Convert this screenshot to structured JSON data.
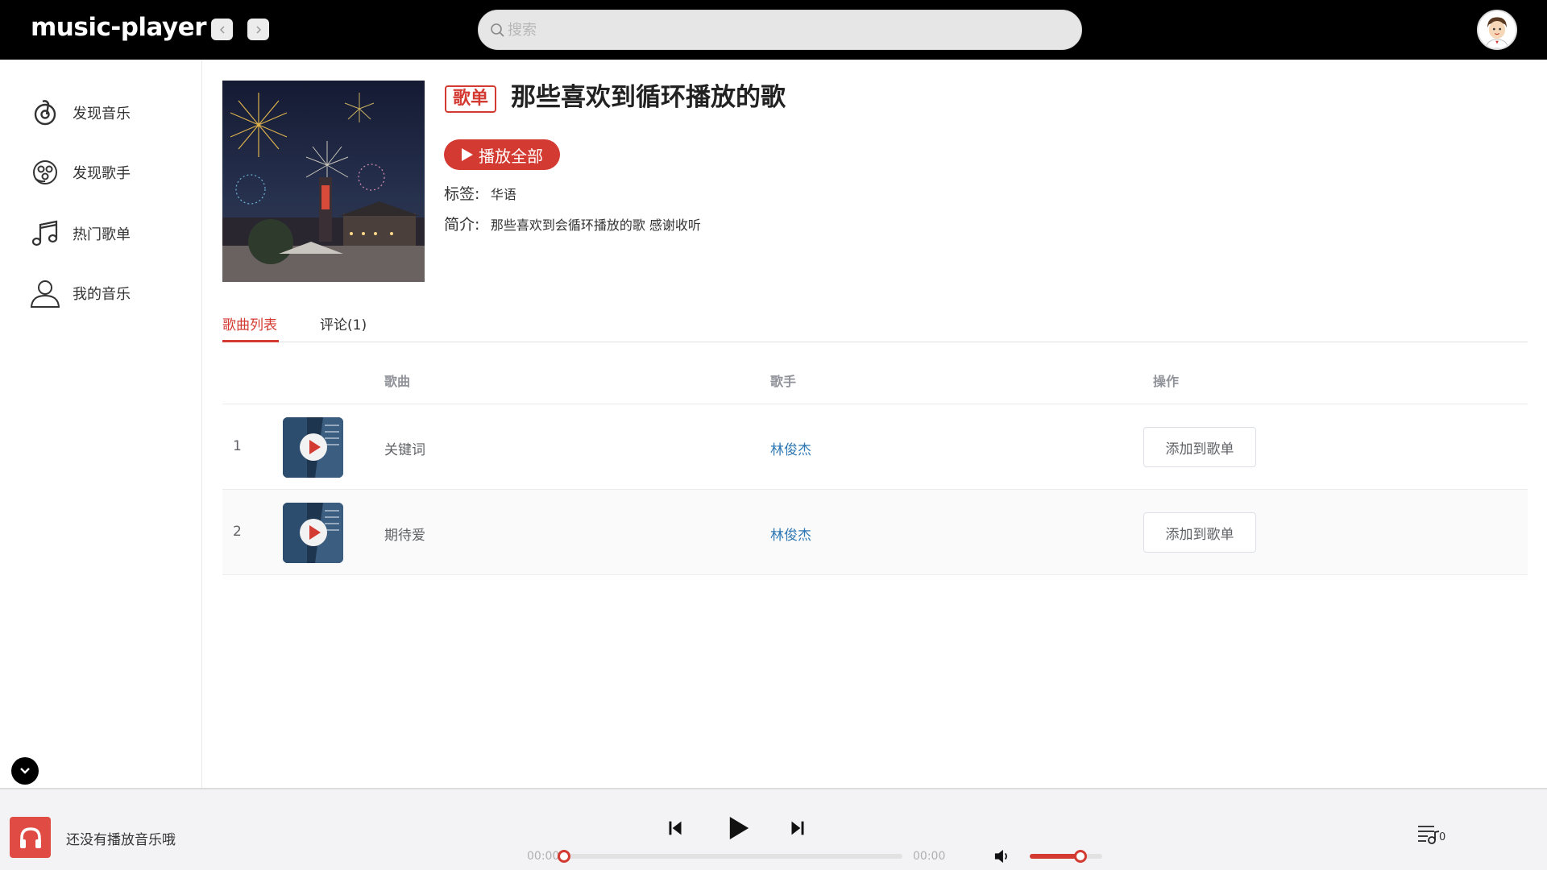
{
  "app": {
    "logo": "music-player"
  },
  "search": {
    "placeholder": "搜索",
    "value": ""
  },
  "sidebar": {
    "items": [
      {
        "label": "发现音乐",
        "icon": "netease-music-icon"
      },
      {
        "label": "发现歌手",
        "icon": "singer-disc-icon"
      },
      {
        "label": "热门歌单",
        "icon": "music-note-icon"
      },
      {
        "label": "我的音乐",
        "icon": "user-icon"
      }
    ]
  },
  "playlist": {
    "badge": "歌单",
    "title": "那些喜欢到循环播放的歌",
    "play_all": "播放全部",
    "tag_label": "标签:",
    "tag_value": "华语",
    "intro_label": "简介:",
    "intro_value": "那些喜欢到会循环播放的歌 感谢收听"
  },
  "tabs": [
    {
      "label": "歌曲列表",
      "active": true
    },
    {
      "label": "评论(1)",
      "active": false
    }
  ],
  "table": {
    "headers": {
      "song": "歌曲",
      "artist": "歌手",
      "action": "操作"
    },
    "rows": [
      {
        "index": "1",
        "song": "关键词",
        "artist": "林俊杰",
        "action": "添加到歌单"
      },
      {
        "index": "2",
        "song": "期待爱",
        "artist": "林俊杰",
        "action": "添加到歌单"
      }
    ]
  },
  "player": {
    "now_playing": "还没有播放音乐哦",
    "current_time": "00:00",
    "total_time": "00:00",
    "progress": 0,
    "volume": 0.7,
    "playlist_count": "0"
  },
  "colors": {
    "accent": "#d33a31",
    "link": "#2f78b4",
    "topbar": "#000000"
  }
}
